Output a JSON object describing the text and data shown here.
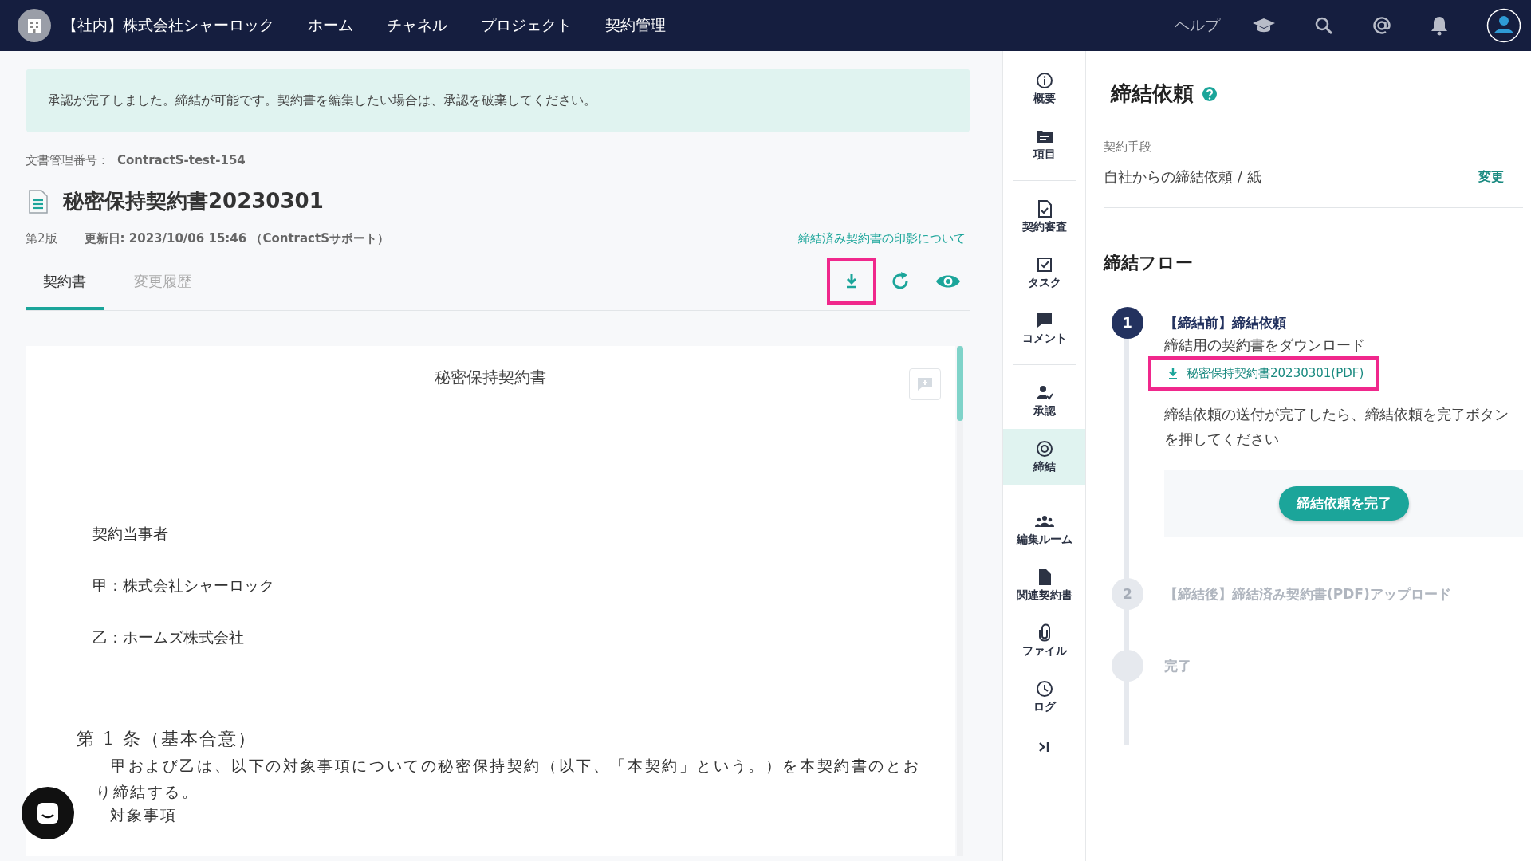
{
  "top_bar": {
    "org": "【社内】株式会社シャーロック",
    "nav": [
      "ホーム",
      "チャネル",
      "プロジェクト",
      "契約管理"
    ],
    "help": "ヘルプ"
  },
  "banner": "承認が完了しました。締結が可能です。契約書を編集したい場合は、承認を破棄してください。",
  "document": {
    "number_label": "文書管理番号：",
    "number": "ContractS-test-154",
    "title": "秘密保持契約書20230301",
    "version": "第2版",
    "updated": "更新日: 2023/10/06 15:46 （ContractSサポート）",
    "seal_link": "締結済み契約書の印影について"
  },
  "tabs": [
    {
      "label": "契約書",
      "selected": true
    },
    {
      "label": "変更履歴",
      "selected": false
    }
  ],
  "contract": {
    "title": "秘密保持契約書",
    "paragraphs": [
      {
        "kind": "party",
        "text": "契約当事者"
      },
      {
        "kind": "party",
        "text": "甲：株式会社シャーロック"
      },
      {
        "kind": "party",
        "text": "乙：ホームズ株式会社"
      },
      {
        "kind": "heading",
        "text": "第 1 条（基本合意）"
      },
      {
        "kind": "body",
        "text": "甲および乙は、以下の対象事項についての秘密保持契約（以下、「本契約」という。）を本契約書のとおり締結する。"
      },
      {
        "kind": "item",
        "text": "対象事項"
      }
    ]
  },
  "sidebar": {
    "groups": [
      [
        {
          "label": "概要",
          "selected": false
        },
        {
          "label": "項目",
          "selected": false
        }
      ],
      [
        {
          "label": "契約審査",
          "selected": false
        },
        {
          "label": "タスク",
          "selected": false
        },
        {
          "label": "コメント",
          "selected": false
        }
      ],
      [
        {
          "label": "承認",
          "selected": false
        },
        {
          "label": "締結",
          "selected": true
        }
      ],
      [
        {
          "label": "編集ルーム",
          "selected": false
        },
        {
          "label": "関連契約書",
          "selected": false
        },
        {
          "label": "ファイル",
          "selected": false
        },
        {
          "label": "ログ",
          "selected": false
        }
      ]
    ]
  },
  "panel": {
    "title": "締結依頼",
    "method_label": "契約手段",
    "method_value": "自社からの締結依頼 / 紙",
    "change": "変更",
    "flow_title": "締結フロー",
    "steps": [
      {
        "number": "1",
        "title": "【締結前】締結依頼",
        "active": true,
        "lead": "締結用の契約書をダウンロード",
        "file_link": "秘密保持契約書20230301(PDF)",
        "note": "締結依頼の送付が完了したら、締結依頼を完了ボタンを押してください",
        "button": "締結依頼を完了"
      },
      {
        "number": "2",
        "title": "【締結後】締結済み契約書(PDF)アップロード",
        "active": false
      },
      {
        "title": "完了",
        "active": false
      }
    ]
  }
}
